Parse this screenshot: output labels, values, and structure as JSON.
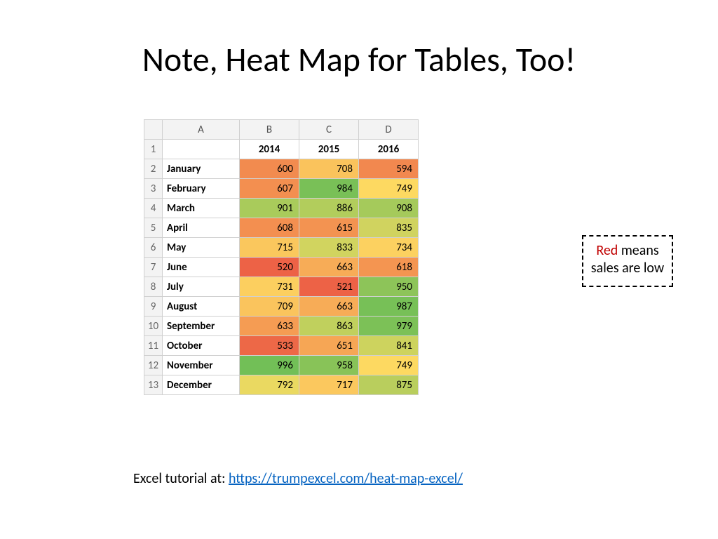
{
  "title": "Note, Heat Map for Tables, Too!",
  "annotation": {
    "red": "Red",
    "rest": " means sales are low"
  },
  "credit": {
    "prefix": "Excel tutorial at: ",
    "link": "https://trumpexcel.com/heat-map-excel/"
  },
  "chart_data": {
    "type": "heatmap",
    "col_letters": [
      "A",
      "B",
      "C",
      "D"
    ],
    "rows": [
      "January",
      "February",
      "March",
      "April",
      "May",
      "June",
      "July",
      "August",
      "September",
      "October",
      "November",
      "December"
    ],
    "columns": [
      "2014",
      "2015",
      "2016"
    ],
    "values": [
      [
        600,
        708,
        594
      ],
      [
        607,
        984,
        749
      ],
      [
        901,
        886,
        908
      ],
      [
        608,
        615,
        835
      ],
      [
        715,
        833,
        734
      ],
      [
        520,
        663,
        618
      ],
      [
        731,
        521,
        950
      ],
      [
        709,
        663,
        987
      ],
      [
        633,
        863,
        979
      ],
      [
        533,
        651,
        841
      ],
      [
        996,
        958,
        749
      ],
      [
        792,
        717,
        875
      ]
    ],
    "value_range": [
      520,
      996
    ]
  }
}
